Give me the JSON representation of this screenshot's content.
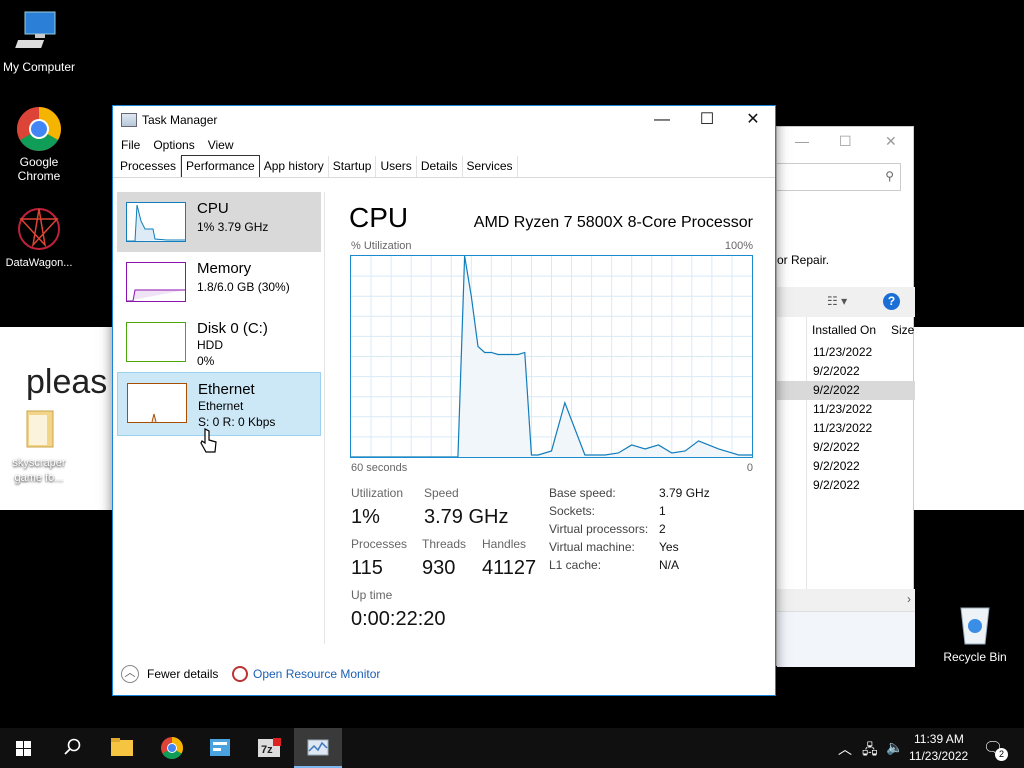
{
  "desktop": {
    "icons": [
      {
        "label": "My Computer"
      },
      {
        "label": "Google Chrome"
      },
      {
        "label": "DataWagon..."
      },
      {
        "label": "skyscraper game fo..."
      },
      {
        "label": "Recycle Bin"
      }
    ],
    "background_text": "pleas"
  },
  "background_window": {
    "partial_text": "or Repair.",
    "columns": [
      "Installed On",
      "Size"
    ],
    "rows": [
      "11/23/2022",
      "9/2/2022",
      "9/2/2022",
      "11/23/2022",
      "11/23/2022",
      "9/2/2022",
      "9/2/2022",
      "9/2/2022"
    ],
    "selected_row": 2
  },
  "task_manager": {
    "title": "Task Manager",
    "menu": [
      "File",
      "Options",
      "View"
    ],
    "tabs": [
      "Processes",
      "Performance",
      "App history",
      "Startup",
      "Users",
      "Details",
      "Services"
    ],
    "active_tab": "Performance",
    "resources": {
      "cpu": {
        "name": "CPU",
        "detail": "1% 3.79 GHz",
        "color": "#117dbb"
      },
      "memory": {
        "name": "Memory",
        "detail": "1.8/6.0 GB (30%)",
        "color": "#8b12ae"
      },
      "disk": {
        "name": "Disk 0 (C:)",
        "detail1": "HDD",
        "detail2": "0%",
        "color": "#4da60c"
      },
      "ethernet": {
        "name": "Ethernet",
        "detail1": "Ethernet",
        "detail2": "S: 0 R: 0 Kbps",
        "color": "#a74f01"
      }
    },
    "cpu_panel": {
      "heading": "CPU",
      "model": "AMD Ryzen 7 5800X 8-Core Processor",
      "graph_label": "% Utilization",
      "graph_max": "100%",
      "graph_time": "60 seconds",
      "graph_min": "0",
      "utilization_label": "Utilization",
      "utilization": "1%",
      "speed_label": "Speed",
      "speed": "3.79 GHz",
      "processes_label": "Processes",
      "processes": "115",
      "threads_label": "Threads",
      "threads": "930",
      "handles_label": "Handles",
      "handles": "41127",
      "uptime_label": "Up time",
      "uptime": "0:00:22:20",
      "specs": [
        {
          "k": "Base speed:",
          "v": "3.79 GHz"
        },
        {
          "k": "Sockets:",
          "v": "1"
        },
        {
          "k": "Virtual processors:",
          "v": "2"
        },
        {
          "k": "Virtual machine:",
          "v": "Yes"
        },
        {
          "k": "L1 cache:",
          "v": "N/A"
        }
      ]
    },
    "footer": {
      "fewer_details": "Fewer details",
      "open_resource_monitor": "Open Resource Monitor"
    }
  },
  "chart_data": {
    "type": "area",
    "x": [
      0,
      5,
      10,
      11,
      12,
      13,
      14,
      15,
      16,
      17,
      18,
      19,
      20,
      21,
      22,
      23,
      24,
      25,
      26,
      27,
      28,
      30,
      32,
      35,
      38,
      40,
      42,
      44,
      46,
      48,
      50,
      52,
      55,
      57,
      58,
      60
    ],
    "values": [
      0,
      0,
      0,
      0,
      0,
      0,
      0,
      0,
      0,
      100,
      80,
      55,
      52,
      52,
      51,
      51,
      51,
      51,
      52,
      1,
      1,
      3,
      27,
      1,
      1,
      2,
      6,
      4,
      6,
      2,
      3,
      8,
      4,
      2,
      1,
      1
    ],
    "ylim": [
      0,
      100
    ],
    "color": "#117dbb"
  },
  "taskbar": {
    "time": "11:39 AM",
    "date": "11/23/2022",
    "notifications": "2"
  }
}
